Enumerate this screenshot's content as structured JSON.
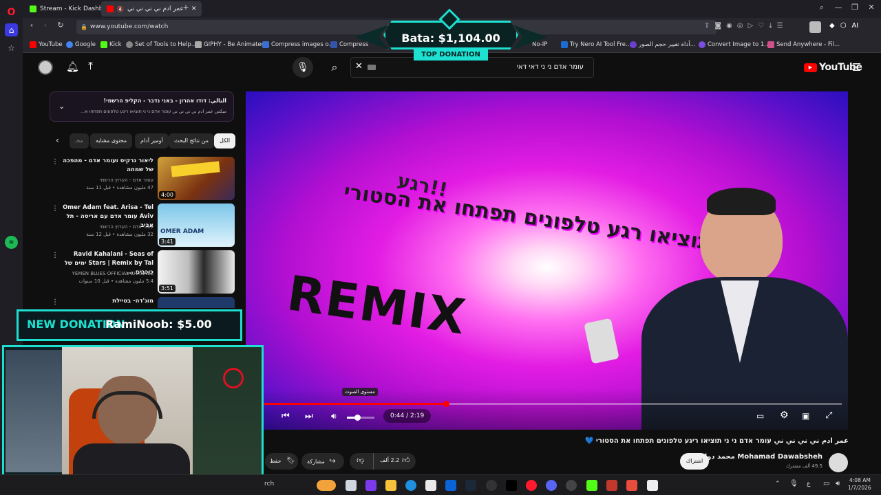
{
  "browser": {
    "tabs": [
      {
        "title": "Stream - Kick Dashboard"
      },
      {
        "title": "عمر ادم ني ني ني ني"
      }
    ],
    "address": "www.youtube.com/watch"
  },
  "bookmarks": [
    {
      "label": "YouTube",
      "color": "#ff0000"
    },
    {
      "label": "Google",
      "color": "#4285f4"
    },
    {
      "label": "Kick",
      "color": "#53fc18"
    },
    {
      "label": "Set of Tools to Help...",
      "color": "#888888"
    },
    {
      "label": "GIPHY - Be Animated",
      "color": "#aaaaaa"
    },
    {
      "label": "Compress images o...",
      "color": "#3b6fd1"
    },
    {
      "label": "Compress",
      "color": "#3355aa"
    },
    {
      "label": "No-IP",
      "color": "#888888"
    },
    {
      "label": "Try Nero AI Tool Fre...",
      "color": "#1d6bd1"
    },
    {
      "label": "أداة تغيير حجم الصور...",
      "color": "#6b3fd1"
    },
    {
      "label": "أداة تغيير حجم الصور...",
      "color": "#6b3fd1"
    },
    {
      "label": "Convert Image to 1...",
      "color": "#7a4fe0"
    },
    {
      "label": "Send Anywhere - Fil...",
      "color": "#d14f8a"
    }
  ],
  "youtube": {
    "logo": "YouTube",
    "search_query": "עומר אדם ני ני דאי דאי",
    "playing": {
      "title": "التالي: דודו אהרון - באני נדבר - הקליפ הרשמי!",
      "subtitle": "ميكس عمر ادم ني ني ني ني עומר אדם ני ני תוציאו ריגע טלפונים תפתחו א..."
    },
    "chips": [
      "الكل",
      "من نتائج البحث",
      "أومير آدام",
      "محتوى مشابه",
      "محـ"
    ],
    "recommendations": [
      {
        "title": "ליאור נרקיס ועומר אדם - מהפכה של שמחה",
        "channel": "עומר אדם - הערוץ הרשמי",
        "meta": "47 مليون مشاهدة • قبل 11 سنة",
        "duration": "4:00"
      },
      {
        "title": "Omer Adam feat. Arisa - Tel Aviv עומר אדם עם אריסה - תל אביב",
        "channel": "עומר אדם - הערוץ הרשמי",
        "meta": "32 مليون مشاهدة • قبل 12 سنة",
        "duration": "3:41"
      },
      {
        "title": "Ravid Kahalani - Seas of Stars | Remix by Tal ימים של כוכבים ...",
        "channel": "YEMEN BLUES OFFICIAL CHANNEL",
        "meta": "5.4 مليون مشاهدة • قبل 10 سنوات",
        "duration": "3:51"
      },
      {
        "title": "מוג'דה- בטיילת",
        "channel": "",
        "meta": "",
        "duration": ""
      }
    ],
    "video": {
      "overlay_line1": "רגע!!",
      "overlay_line2": "תוציאו רגע טלפונים תפתחו את הסטורי",
      "overlay_remix": "REMIX",
      "time": "0:44 / 2:19",
      "progress": 0.316,
      "volume_tooltip": "مستوى الصوت",
      "title": "عمر ادم ني ني ني ني עומר אדם ני ני תוציאו ריגע טלפונים תפתחו את הסטורי 💙",
      "channel": "Mohamad Dawabsheh محمد دوابشة",
      "subscribers": "49.5 ألف مشترك",
      "subscribe": "اشتراك",
      "likes": "2.2 ألف",
      "share": "مشاركة",
      "save": "حفظ"
    }
  },
  "stream": {
    "top_donation_amount": "Bata: $1,104.00",
    "top_donation_label": "TOP DONATION",
    "new_donation_label": "NEW DONATION",
    "new_donation_value": "RamiNoob: $5.00"
  },
  "taskbar": {
    "search_text": "rch",
    "lang": "ع",
    "time": "4:08 AM",
    "date": "1/7/2026"
  }
}
